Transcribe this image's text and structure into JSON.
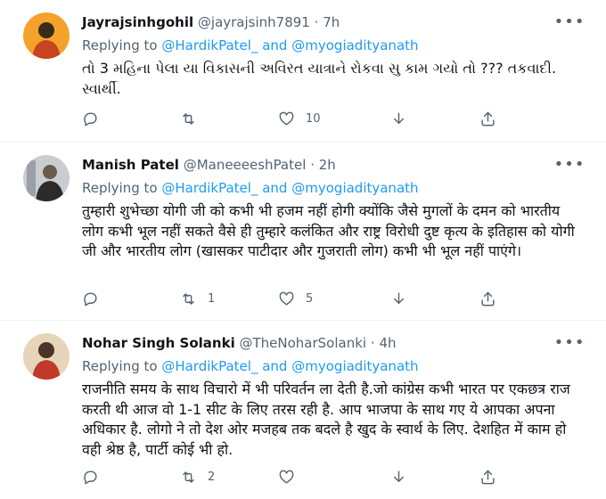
{
  "tweets": [
    {
      "name": "Jayrajsinhgohil",
      "handle": "@jayrajsinh7891",
      "time": "7h",
      "replying_label": "Replying to",
      "mention1": "@HardikPatel_",
      "and_label": "and",
      "mention2": "@myogiadityanath",
      "text": "તો 3 મહિના પેલા યા વિકાસની અવિરત યાત્રાને રોકવા સુ કામ ગયો તો ??? તકવાદી. સ્વાર્થી.",
      "replies": "",
      "retweets": "",
      "likes": "10",
      "avatar_colors": [
        "#f4a22b",
        "#3a2a1a",
        "#c8431f"
      ]
    },
    {
      "name": "Manish Patel",
      "handle": "@ManeeeeshPatel",
      "time": "2h",
      "replying_label": "Replying to",
      "mention1": "@HardikPatel_",
      "and_label": "and",
      "mention2": "@myogiadityanath",
      "text": "तुम्हारी शुभेच्छा योगी जी को कभी भी हजम नहीं होगी क्योंकि जैसे मुगलों के दमन को भारतीय लोग कभी भूल नहीं सकते वैसे ही तुम्हारे कलंकित और राष्ट्र विरोधी दुष्ट कृत्य के इतिहास को योगी जी और भारतीय लोग (खासकर पाटीदार और गुजराती लोग) कभी भी भूल नहीं पाएंगे।",
      "replies": "",
      "retweets": "1",
      "likes": "5",
      "avatar_colors": [
        "#c9ccd1",
        "#6b5b4a",
        "#2b2b2b"
      ]
    },
    {
      "name": "Nohar Singh Solanki",
      "handle": "@TheNoharSolanki",
      "time": "4h",
      "replying_label": "Replying to",
      "mention1": "@HardikPatel_",
      "and_label": "and",
      "mention2": "@myogiadityanath",
      "text": "राजनीति समय के साथ विचारो में भी परिवर्तन ला देती है.जो कांग्रेस कभी भारत पर एकछत्र राज करती थी आज वो 1-1 सीट के लिए तरस रही है. आप भाजपा के साथ गए ये आपका अपना अधिकार है. लोगो ने तो देश ओर मजहब तक बदले है खुद के स्वार्थ के लिए. देशहित में काम हो वही श्रेष्ठ है, पार्टी कोई भी हो.",
      "replies": "",
      "retweets": "2",
      "likes": "",
      "avatar_colors": [
        "#e6d5b8",
        "#4a3526",
        "#c0392b"
      ]
    }
  ]
}
